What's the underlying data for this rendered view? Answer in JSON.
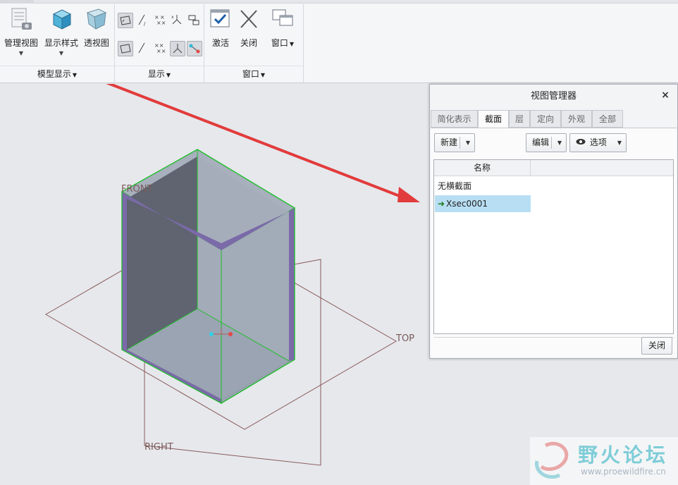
{
  "ribbon": {
    "model_display": {
      "group_label": "模型显示",
      "buttons": [
        {
          "label": "管理视图",
          "icon": "manage-views-icon"
        },
        {
          "label": "显示样式",
          "icon": "display-style-icon"
        },
        {
          "label": "透视图",
          "icon": "perspective-icon"
        }
      ]
    },
    "show": {
      "group_label": "显示",
      "icons": [
        "plane-display-icon",
        "axis-display-icon",
        "point-display-icon",
        "csys-display-icon",
        "annotation-display-icon",
        "plane-tag-icon",
        "axis-tag-icon",
        "point-tag-icon",
        "csys-tag-icon",
        "spin-center-icon"
      ]
    },
    "window": {
      "group_label": "窗口",
      "buttons": [
        {
          "label": "激活",
          "icon": "activate-icon"
        },
        {
          "label": "关闭",
          "icon": "close-window-icon"
        },
        {
          "label": "窗口",
          "icon": "windows-icon"
        }
      ]
    }
  },
  "viewport": {
    "labels": {
      "front": "FRONT",
      "top": "TOP",
      "right": "RIGHT"
    }
  },
  "dialog": {
    "title": "视图管理器",
    "tabs": [
      "简化表示",
      "截面",
      "层",
      "定向",
      "外观",
      "全部"
    ],
    "active_tab": "截面",
    "toolbar": {
      "new": "新建",
      "edit": "编辑",
      "options": "选项"
    },
    "list": {
      "header": "名称",
      "rows": [
        {
          "name": "无横截面",
          "selected": false
        },
        {
          "name": "Xsec0001",
          "selected": true
        }
      ]
    },
    "close_button": "关闭"
  },
  "watermark": {
    "text": "野火论坛",
    "url": "www.proewildfire.cn"
  },
  "colors": {
    "selection": "#b8def3",
    "annotation_arrow": "#e23b3b",
    "model_edge": "#1fbf2a"
  }
}
